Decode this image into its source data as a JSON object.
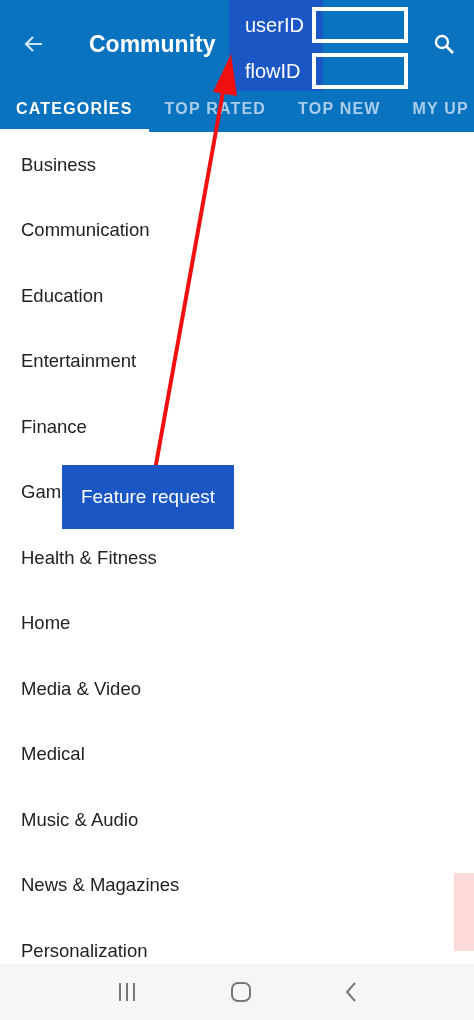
{
  "app_bar": {
    "title": "Community"
  },
  "tabs": [
    {
      "label": "CATEGORİES",
      "selected": true
    },
    {
      "label": "TOP RATED",
      "selected": false
    },
    {
      "label": "TOP NEW",
      "selected": false
    },
    {
      "label": "MY UP",
      "selected": false
    }
  ],
  "categories": [
    "Business",
    "Communication",
    "Education",
    "Entertainment",
    "Finance",
    "Gam",
    "Health & Fitness",
    "Home",
    "Media & Video",
    "Medical",
    "Music & Audio",
    "News & Magazines",
    "Personalization"
  ],
  "annotation": {
    "fields": [
      "userID",
      "flowID"
    ],
    "label": "Feature request"
  }
}
